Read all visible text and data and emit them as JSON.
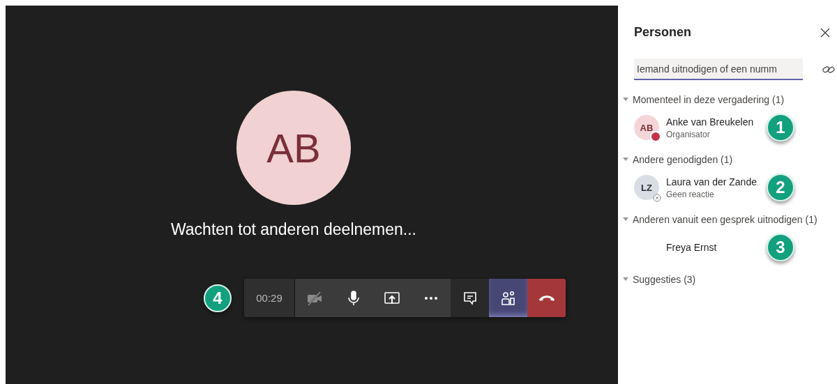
{
  "stage": {
    "avatar_initials": "AB",
    "status": "Wachten tot anderen deelnemen...",
    "toolbar": {
      "timer": "00:29",
      "callout": "4",
      "buttons": [
        {
          "kind": "camera",
          "selected": false
        },
        {
          "kind": "mic",
          "selected": false
        },
        {
          "kind": "share",
          "selected": false
        },
        {
          "kind": "more",
          "selected": false
        },
        {
          "kind": "chat",
          "selected": false
        },
        {
          "kind": "people",
          "selected": true
        },
        {
          "kind": "hangup",
          "selected": false
        }
      ]
    }
  },
  "panel": {
    "title": "Personen",
    "search": {
      "placeholder": "Iemand uitnodigen of een numm"
    },
    "sections": [
      {
        "label": "Momenteel in deze vergadering (1)",
        "expanded": true,
        "people": [
          {
            "initials": "AB",
            "name": "Anke van Breukelen",
            "status": "Organisator",
            "kind": "busy",
            "callout": "1"
          }
        ]
      },
      {
        "label": "Andere genodigden (1)",
        "expanded": true,
        "people": [
          {
            "initials": "LZ",
            "name": "Laura van der Zande",
            "status": "Geen reactie",
            "kind": "unknown",
            "callout": "2"
          }
        ]
      },
      {
        "label": "Anderen vanuit een gesprek uitnodigen (1)",
        "expanded": true,
        "people": [
          {
            "name": "Freya Ernst",
            "callout": "3"
          }
        ]
      },
      {
        "label": "Suggesties (3)",
        "expanded": true
      }
    ]
  }
}
